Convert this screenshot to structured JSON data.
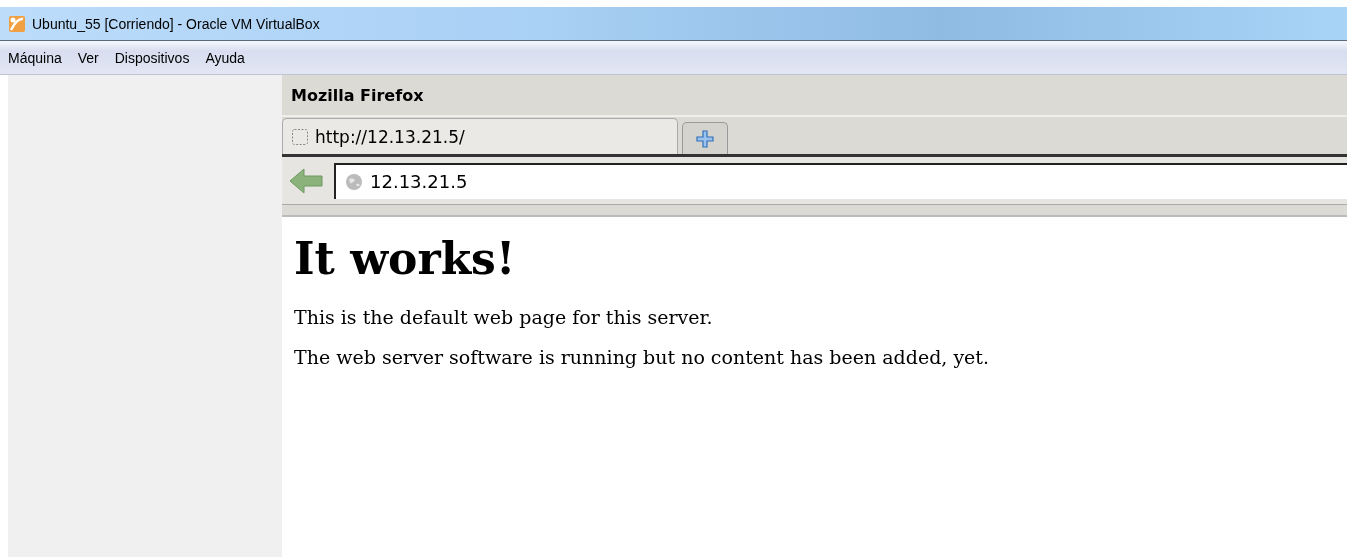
{
  "window": {
    "title": "Ubuntu_55 [Corriendo] - Oracle VM VirtualBox"
  },
  "menu": [
    "Máquina",
    "Ver",
    "Dispositivos",
    "Ayuda"
  ],
  "browser": {
    "title": "Mozilla Firefox",
    "tabs": [
      {
        "label": "http://12.13.21.5/",
        "selected": true
      }
    ],
    "address": "12.13.21.5",
    "page": {
      "heading": "It works!",
      "paragraphs": [
        "This is the default web page for this server.",
        "The web server software is running but no content has been added, yet."
      ]
    }
  }
}
